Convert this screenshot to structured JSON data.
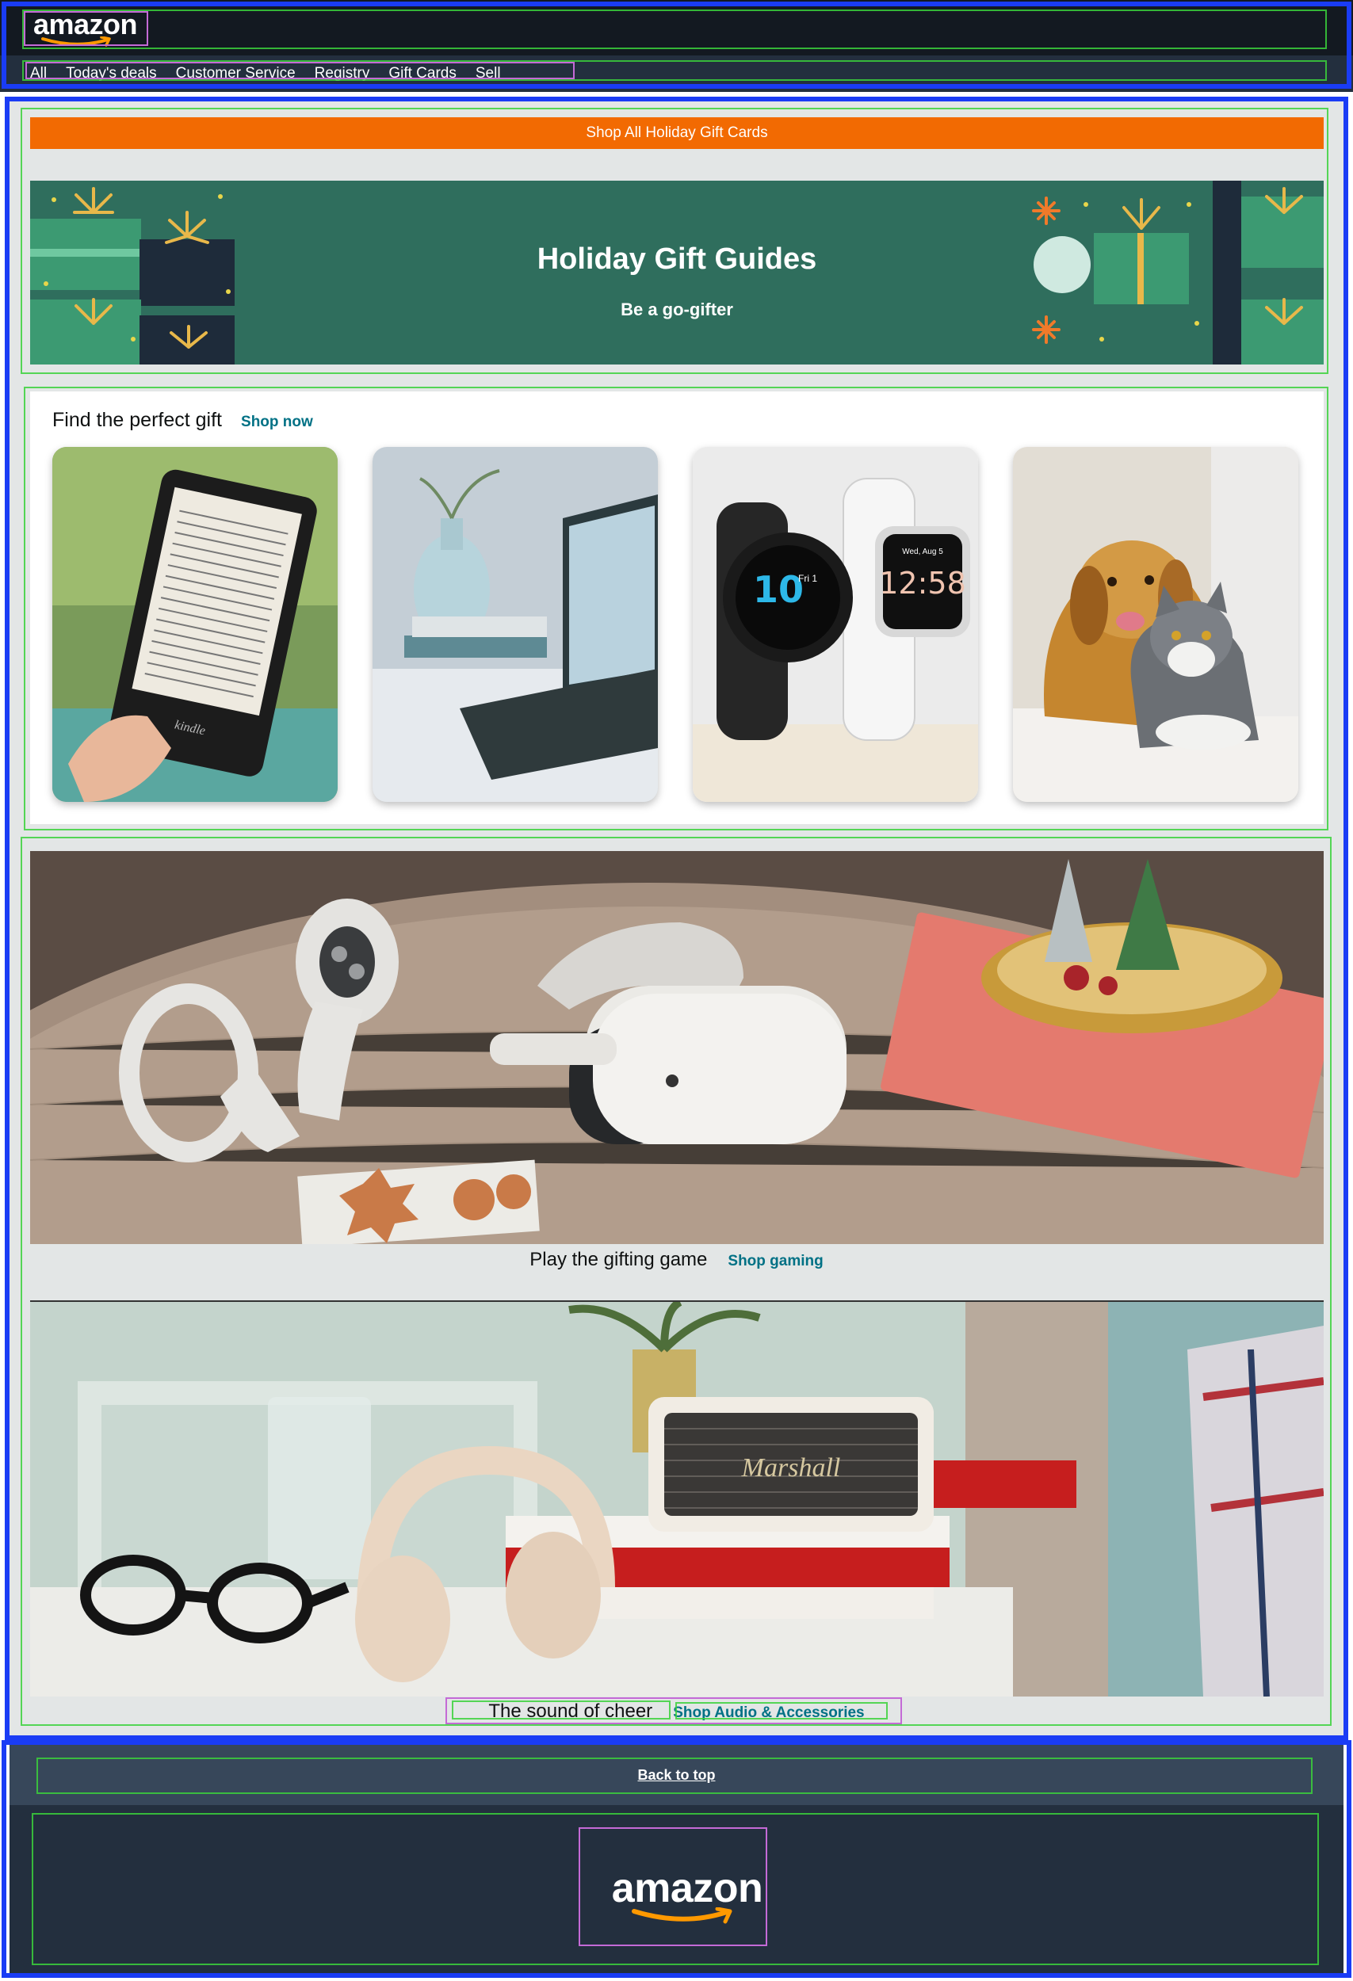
{
  "header": {
    "logo_text": "amazon",
    "nav": [
      "All",
      "Today's deals",
      "Customer Service",
      "Registry",
      "Gift Cards",
      "Sell"
    ]
  },
  "promo": {
    "label": "Shop All Holiday Gift Cards"
  },
  "hero": {
    "title": "Holiday Gift Guides",
    "subtitle": "Be a go-gifter"
  },
  "gifts": {
    "title": "Find the perfect gift",
    "link": "Shop now",
    "tiles": [
      "kindle-ereader-image",
      "laptop-desk-image",
      "smartwatches-image",
      "dog-and-cat-image"
    ],
    "kindle_brand": "kindle",
    "watch1_time": "10",
    "watch1_date": "Fri 1",
    "watch2_time": "12:58",
    "watch2_date": "Wed, Aug 5"
  },
  "gaming": {
    "title": "Play the gifting game",
    "link": "Shop gaming"
  },
  "audio": {
    "title": "The sound of cheer",
    "link": "Shop Audio & Accessories",
    "speaker_brand": "Marshall"
  },
  "footer": {
    "back_to_top": "Back to top",
    "logo_text": "amazon"
  },
  "colors": {
    "header_dark": "#131921",
    "nav": "#232f3e",
    "accent_orange": "#f26a02",
    "hero_green": "#2f6e5d",
    "link_teal": "#007185",
    "page_bg": "#e3e6e6"
  }
}
